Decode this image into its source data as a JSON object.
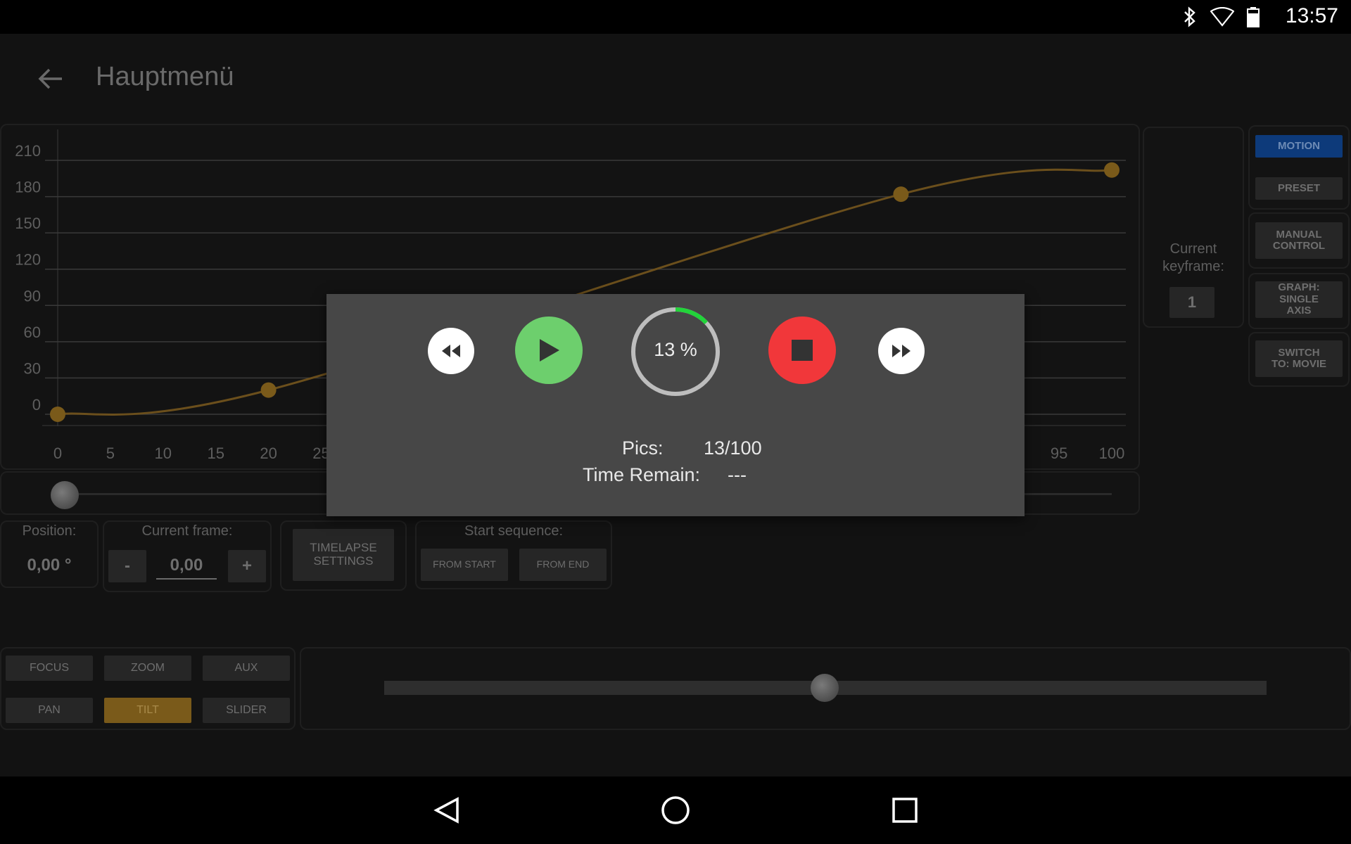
{
  "status_bar": {
    "time": "13:57"
  },
  "app_bar": {
    "title": "Hauptmenü"
  },
  "chart_data": {
    "type": "line",
    "x_ticks": [
      0,
      5,
      10,
      15,
      20,
      25,
      95,
      100
    ],
    "y_ticks": [
      0,
      30,
      60,
      90,
      120,
      150,
      180,
      210
    ],
    "xlim": [
      0,
      100
    ],
    "ylim": [
      0,
      210
    ],
    "keyframes": [
      {
        "x": 0,
        "y": 0
      },
      {
        "x": 20,
        "y": 20
      },
      {
        "x": 80,
        "y": 182
      },
      {
        "x": 100,
        "y": 202
      }
    ],
    "grid": true,
    "line_color": "#6b4f1c",
    "point_color": "#7a5a1a"
  },
  "keyframe_panel": {
    "label": "Current keyframe:",
    "value": "1"
  },
  "mode_buttons": {
    "motion": "MOTION",
    "preset": "PRESET",
    "manual_control": "MANUAL CONTROL",
    "graph": "GRAPH: SINGLE AXIS",
    "switch": "SWITCH TO: MOVIE"
  },
  "position": {
    "label": "Position:",
    "value": "0,00 °"
  },
  "current_frame": {
    "label": "Current frame:",
    "minus": "-",
    "value": "0,00",
    "plus": "+"
  },
  "timelapse": {
    "label": "TIMELAPSE SETTINGS"
  },
  "start_sequence": {
    "label": "Start sequence:",
    "from_start": "FROM START",
    "from_end": "FROM END"
  },
  "axis_buttons": {
    "focus": "FOCUS",
    "zoom": "ZOOM",
    "aux": "AUX",
    "pan": "PAN",
    "tilt": "TILT",
    "slider": "SLIDER"
  },
  "dialog": {
    "progress_text": "13 %",
    "progress": 0.13,
    "pics_label": "Pics:",
    "pics_value": "13/100",
    "time_label": "Time Remain:",
    "time_value": "---"
  },
  "colors": {
    "accent_blue": "#0d3a7a",
    "tilt_active": "#7a5a1a",
    "play_green": "#6dcf6d",
    "stop_red": "#f1373a",
    "progress_green": "#22d43a"
  }
}
